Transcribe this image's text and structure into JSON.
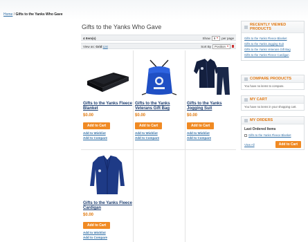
{
  "breadcrumb": {
    "home": "Home",
    "separator": "/",
    "current": "Gifts to the Yanks Who Gave"
  },
  "page": {
    "title": "Gifts to the Yanks Who Gave"
  },
  "toolbar": {
    "item_count": "4 Item(s)",
    "show_label": "Show",
    "show_value": "9",
    "per_page_label": "per page",
    "view_as_label": "View as:",
    "view_grid": "Grid",
    "view_list": "List",
    "sort_by_label": "Sort By",
    "sort_value": "Position"
  },
  "products": [
    {
      "name": "Gifts to the Yanks Fleece Blanket",
      "price": "$0.00",
      "cart_label": "Add to Cart",
      "wishlist_label": "Add to Wishlist",
      "compare_label": "Add to Compare"
    },
    {
      "name": "Gifts to the Yanks Veterans Gift Bag",
      "price": "$0.00",
      "cart_label": "Add to Cart",
      "wishlist_label": "Add to Wishlist",
      "compare_label": "Add to Compare"
    },
    {
      "name": "Gifts to the Yanks Jogging Suit",
      "price": "$0.00",
      "cart_label": "Add to Cart",
      "wishlist_label": "Add to Wishlist",
      "compare_label": "Add to Compare"
    },
    {
      "name": "Gifts to the Yanks Fleece Cardigan",
      "price": "$0.00",
      "cart_label": "Add to Cart",
      "wishlist_label": "Add to Wishlist",
      "compare_label": "Add to Compare"
    }
  ],
  "sidebar": {
    "recently_viewed": {
      "title": "Recently Viewed Products",
      "items": [
        "Gifts to the Yanks Fleece Blanket",
        "Gifts to the Yanks Jogging Suit",
        "Gifts to the Yanks Veterans Gift Bag",
        "Gifts to the Yanks Fleece Cardigan"
      ]
    },
    "compare": {
      "title": "Compare Products",
      "text": "You have no items to compare."
    },
    "cart": {
      "title": "My Cart",
      "text": "You have no items in your shopping cart."
    },
    "orders": {
      "title": "My Orders",
      "subtitle": "Last Ordered Items",
      "item": "Gifts to the Yanks Fleece Blanket",
      "view_all": "View All",
      "cart_label": "Add to Cart"
    }
  },
  "colors": {
    "accent": "#f08a24",
    "link": "#2e6da4",
    "title_orange": "#e0760e"
  }
}
